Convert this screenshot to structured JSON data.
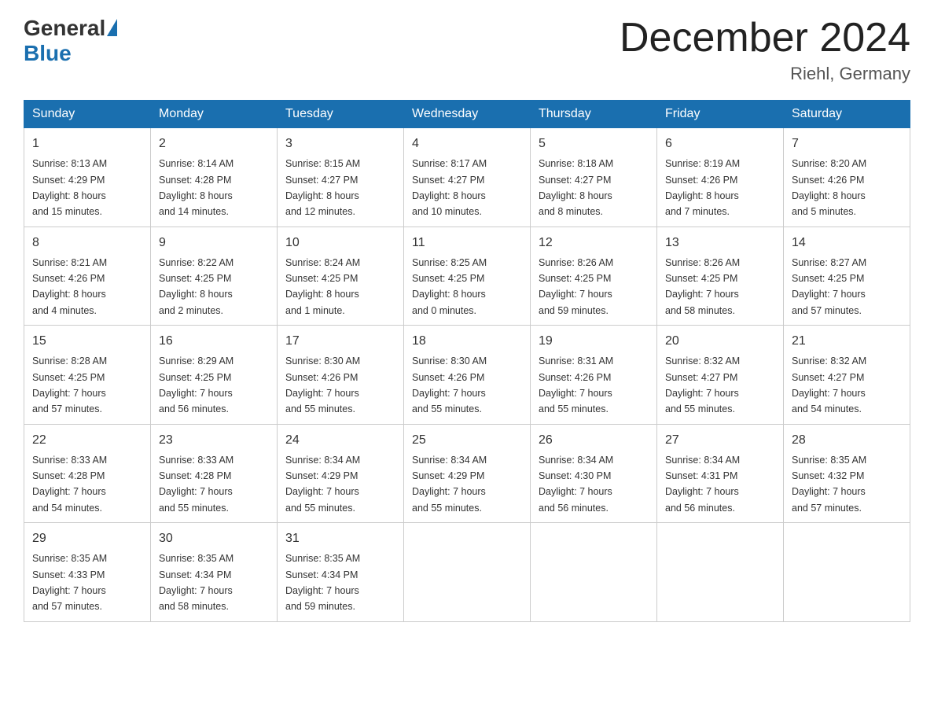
{
  "logo": {
    "general": "General",
    "blue": "Blue",
    "arrow": "▶"
  },
  "title": "December 2024",
  "location": "Riehl, Germany",
  "days_of_week": [
    "Sunday",
    "Monday",
    "Tuesday",
    "Wednesday",
    "Thursday",
    "Friday",
    "Saturday"
  ],
  "weeks": [
    [
      {
        "day": "1",
        "info": "Sunrise: 8:13 AM\nSunset: 4:29 PM\nDaylight: 8 hours\nand 15 minutes."
      },
      {
        "day": "2",
        "info": "Sunrise: 8:14 AM\nSunset: 4:28 PM\nDaylight: 8 hours\nand 14 minutes."
      },
      {
        "day": "3",
        "info": "Sunrise: 8:15 AM\nSunset: 4:27 PM\nDaylight: 8 hours\nand 12 minutes."
      },
      {
        "day": "4",
        "info": "Sunrise: 8:17 AM\nSunset: 4:27 PM\nDaylight: 8 hours\nand 10 minutes."
      },
      {
        "day": "5",
        "info": "Sunrise: 8:18 AM\nSunset: 4:27 PM\nDaylight: 8 hours\nand 8 minutes."
      },
      {
        "day": "6",
        "info": "Sunrise: 8:19 AM\nSunset: 4:26 PM\nDaylight: 8 hours\nand 7 minutes."
      },
      {
        "day": "7",
        "info": "Sunrise: 8:20 AM\nSunset: 4:26 PM\nDaylight: 8 hours\nand 5 minutes."
      }
    ],
    [
      {
        "day": "8",
        "info": "Sunrise: 8:21 AM\nSunset: 4:26 PM\nDaylight: 8 hours\nand 4 minutes."
      },
      {
        "day": "9",
        "info": "Sunrise: 8:22 AM\nSunset: 4:25 PM\nDaylight: 8 hours\nand 2 minutes."
      },
      {
        "day": "10",
        "info": "Sunrise: 8:24 AM\nSunset: 4:25 PM\nDaylight: 8 hours\nand 1 minute."
      },
      {
        "day": "11",
        "info": "Sunrise: 8:25 AM\nSunset: 4:25 PM\nDaylight: 8 hours\nand 0 minutes."
      },
      {
        "day": "12",
        "info": "Sunrise: 8:26 AM\nSunset: 4:25 PM\nDaylight: 7 hours\nand 59 minutes."
      },
      {
        "day": "13",
        "info": "Sunrise: 8:26 AM\nSunset: 4:25 PM\nDaylight: 7 hours\nand 58 minutes."
      },
      {
        "day": "14",
        "info": "Sunrise: 8:27 AM\nSunset: 4:25 PM\nDaylight: 7 hours\nand 57 minutes."
      }
    ],
    [
      {
        "day": "15",
        "info": "Sunrise: 8:28 AM\nSunset: 4:25 PM\nDaylight: 7 hours\nand 57 minutes."
      },
      {
        "day": "16",
        "info": "Sunrise: 8:29 AM\nSunset: 4:25 PM\nDaylight: 7 hours\nand 56 minutes."
      },
      {
        "day": "17",
        "info": "Sunrise: 8:30 AM\nSunset: 4:26 PM\nDaylight: 7 hours\nand 55 minutes."
      },
      {
        "day": "18",
        "info": "Sunrise: 8:30 AM\nSunset: 4:26 PM\nDaylight: 7 hours\nand 55 minutes."
      },
      {
        "day": "19",
        "info": "Sunrise: 8:31 AM\nSunset: 4:26 PM\nDaylight: 7 hours\nand 55 minutes."
      },
      {
        "day": "20",
        "info": "Sunrise: 8:32 AM\nSunset: 4:27 PM\nDaylight: 7 hours\nand 55 minutes."
      },
      {
        "day": "21",
        "info": "Sunrise: 8:32 AM\nSunset: 4:27 PM\nDaylight: 7 hours\nand 54 minutes."
      }
    ],
    [
      {
        "day": "22",
        "info": "Sunrise: 8:33 AM\nSunset: 4:28 PM\nDaylight: 7 hours\nand 54 minutes."
      },
      {
        "day": "23",
        "info": "Sunrise: 8:33 AM\nSunset: 4:28 PM\nDaylight: 7 hours\nand 55 minutes."
      },
      {
        "day": "24",
        "info": "Sunrise: 8:34 AM\nSunset: 4:29 PM\nDaylight: 7 hours\nand 55 minutes."
      },
      {
        "day": "25",
        "info": "Sunrise: 8:34 AM\nSunset: 4:29 PM\nDaylight: 7 hours\nand 55 minutes."
      },
      {
        "day": "26",
        "info": "Sunrise: 8:34 AM\nSunset: 4:30 PM\nDaylight: 7 hours\nand 56 minutes."
      },
      {
        "day": "27",
        "info": "Sunrise: 8:34 AM\nSunset: 4:31 PM\nDaylight: 7 hours\nand 56 minutes."
      },
      {
        "day": "28",
        "info": "Sunrise: 8:35 AM\nSunset: 4:32 PM\nDaylight: 7 hours\nand 57 minutes."
      }
    ],
    [
      {
        "day": "29",
        "info": "Sunrise: 8:35 AM\nSunset: 4:33 PM\nDaylight: 7 hours\nand 57 minutes."
      },
      {
        "day": "30",
        "info": "Sunrise: 8:35 AM\nSunset: 4:34 PM\nDaylight: 7 hours\nand 58 minutes."
      },
      {
        "day": "31",
        "info": "Sunrise: 8:35 AM\nSunset: 4:34 PM\nDaylight: 7 hours\nand 59 minutes."
      },
      null,
      null,
      null,
      null
    ]
  ]
}
